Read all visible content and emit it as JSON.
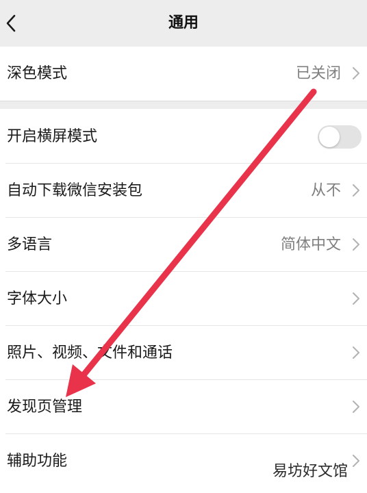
{
  "header": {
    "back_icon": "chevron-left-icon",
    "title": "通用"
  },
  "dark_mode": {
    "label": "深色模式",
    "value": "已关闭"
  },
  "settings": {
    "landscape": {
      "label": "开启横屏模式",
      "toggle_on": false
    },
    "auto_download": {
      "label": "自动下载微信安装包",
      "value": "从不"
    },
    "language": {
      "label": "多语言",
      "value": "简体中文"
    },
    "font_size": {
      "label": "字体大小"
    },
    "media": {
      "label": "照片、视频、文件和通话"
    },
    "discover": {
      "label": "发现页管理"
    },
    "accessibility": {
      "label": "辅助功能"
    }
  },
  "overlay": {
    "arrow_color": "#e8334a",
    "watermark": "易坊好文馆"
  },
  "colors": {
    "header_bg": "#ededed",
    "value_text": "#7f7f7f",
    "toggle_off": "#e3e3e3"
  }
}
